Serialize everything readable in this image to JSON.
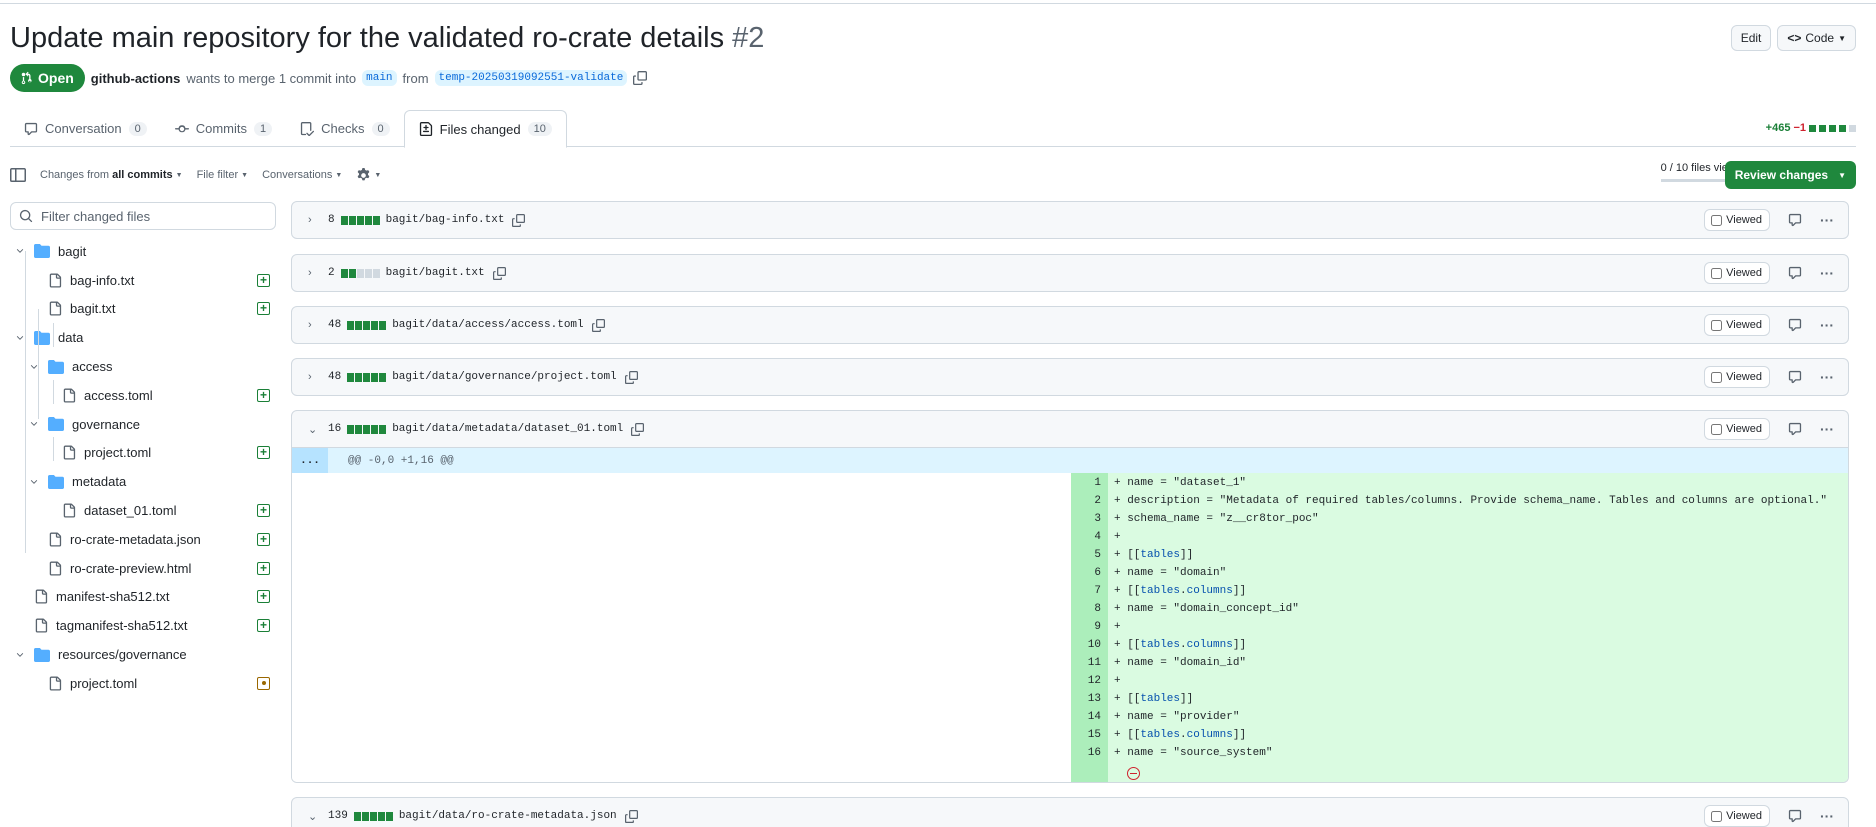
{
  "pr": {
    "title": "Update main repository for the validated ro-crate details",
    "number": "#2",
    "state": "Open",
    "author": "github-actions",
    "merge_text": "wants to merge 1 commit into",
    "base_branch": "main",
    "from_text": "from",
    "head_branch": "temp-20250319092551-validate",
    "edit_label": "Edit",
    "code_label": "Code"
  },
  "tabs": [
    {
      "label": "Conversation",
      "count": "0"
    },
    {
      "label": "Commits",
      "count": "1"
    },
    {
      "label": "Checks",
      "count": "0"
    },
    {
      "label": "Files changed",
      "count": "10"
    }
  ],
  "diffstat": {
    "additions": "+465",
    "deletions": "−1"
  },
  "toolbar": {
    "changes_prefix": "Changes from",
    "changes_value": "all commits",
    "file_filter": "File filter",
    "conversations": "Conversations",
    "viewed_count": "0 / 10 files viewed",
    "review_label": "Review changes"
  },
  "filter": {
    "placeholder": "Filter changed files"
  },
  "tree": [
    {
      "name": "bagit",
      "type": "folder"
    },
    {
      "name": "bag-info.txt",
      "type": "file",
      "status": "added"
    },
    {
      "name": "bagit.txt",
      "type": "file",
      "status": "added"
    },
    {
      "name": "data",
      "type": "folder"
    },
    {
      "name": "access",
      "type": "folder"
    },
    {
      "name": "access.toml",
      "type": "file",
      "status": "added"
    },
    {
      "name": "governance",
      "type": "folder"
    },
    {
      "name": "project.toml",
      "type": "file",
      "status": "added"
    },
    {
      "name": "metadata",
      "type": "folder"
    },
    {
      "name": "dataset_01.toml",
      "type": "file",
      "status": "added"
    },
    {
      "name": "ro-crate-metadata.json",
      "type": "file",
      "status": "added"
    },
    {
      "name": "ro-crate-preview.html",
      "type": "file",
      "status": "added"
    },
    {
      "name": "manifest-sha512.txt",
      "type": "file",
      "status": "added"
    },
    {
      "name": "tagmanifest-sha512.txt",
      "type": "file",
      "status": "added"
    },
    {
      "name": "resources/governance",
      "type": "folder"
    },
    {
      "name": "project.toml",
      "type": "file",
      "status": "modified"
    }
  ],
  "files": [
    {
      "count": "8",
      "path": "bagit/bag-info.txt",
      "viewed_label": "Viewed",
      "blocks": [
        1,
        1,
        1,
        1,
        1
      ]
    },
    {
      "count": "2",
      "path": "bagit/bagit.txt",
      "viewed_label": "Viewed",
      "blocks": [
        1,
        1,
        0,
        0,
        0
      ]
    },
    {
      "count": "48",
      "path": "bagit/data/access/access.toml",
      "viewed_label": "Viewed",
      "blocks": [
        1,
        1,
        1,
        1,
        1
      ]
    },
    {
      "count": "48",
      "path": "bagit/data/governance/project.toml",
      "viewed_label": "Viewed",
      "blocks": [
        1,
        1,
        1,
        1,
        1
      ]
    },
    {
      "count": "16",
      "path": "bagit/data/metadata/dataset_01.toml",
      "viewed_label": "Viewed",
      "blocks": [
        1,
        1,
        1,
        1,
        1
      ]
    },
    {
      "count": "139",
      "path": "bagit/data/ro-crate-metadata.json",
      "viewed_label": "Viewed",
      "blocks": [
        1,
        1,
        1,
        1,
        1
      ]
    }
  ],
  "diff": {
    "expander": "...",
    "hunk_header": "@@ -0,0 +1,16 @@",
    "lines": [
      {
        "n": "1",
        "text": "+ name = \"dataset_1\""
      },
      {
        "n": "2",
        "text": "+ description = \"Metadata of required tables/columns. Provide schema_name. Tables and columns are optional.\""
      },
      {
        "n": "3",
        "text": "+ schema_name = \"z__cr8tor_poc\""
      },
      {
        "n": "4",
        "text": "+"
      },
      {
        "n": "5",
        "text": "+ [[tables]]"
      },
      {
        "n": "6",
        "text": "+ name = \"domain\""
      },
      {
        "n": "7",
        "text": "+ [[tables.columns]]"
      },
      {
        "n": "8",
        "text": "+ name = \"domain_concept_id\""
      },
      {
        "n": "9",
        "text": "+"
      },
      {
        "n": "10",
        "text": "+ [[tables.columns]]"
      },
      {
        "n": "11",
        "text": "+ name = \"domain_id\""
      },
      {
        "n": "12",
        "text": "+"
      },
      {
        "n": "13",
        "text": "+ [[tables]]"
      },
      {
        "n": "14",
        "text": "+ name = \"provider\""
      },
      {
        "n": "15",
        "text": "+ [[tables.columns]]"
      },
      {
        "n": "16",
        "text": "+ name = \"source_system\""
      }
    ]
  },
  "colors": {
    "green": "#1f883d",
    "add_bg": "#dafbe1",
    "add_num_bg": "#aceebb",
    "hunk_bg": "#ddf4ff",
    "deleted": "#cf222e",
    "modified": "#9a6700"
  }
}
